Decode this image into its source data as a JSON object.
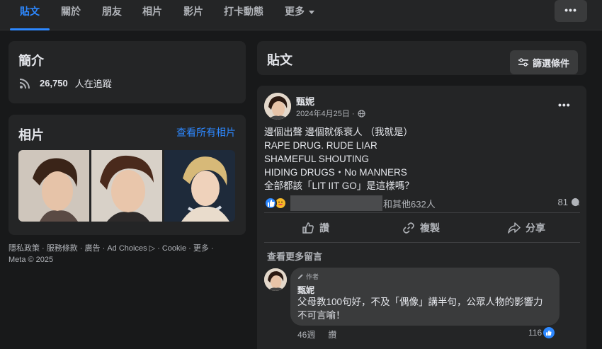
{
  "nav": {
    "tabs": [
      {
        "label": "貼文",
        "active": true
      },
      {
        "label": "關於"
      },
      {
        "label": "朋友"
      },
      {
        "label": "相片"
      },
      {
        "label": "影片"
      },
      {
        "label": "打卡動態"
      },
      {
        "label": "更多"
      }
    ],
    "more_menu_glyph": "•••"
  },
  "intro": {
    "title": "簡介",
    "followers_count": "26,750",
    "followers_text": "人在追蹤",
    "icon": "rss-feed-icon"
  },
  "photos": {
    "title": "相片",
    "see_all_label": "查看所有相片",
    "count_shown": 3
  },
  "footer": {
    "line1": "隱私政策 · 服務條款 · 廣告 · Ad Choices ▷ · Cookie · 更多 ·",
    "line2": "Meta © 2025"
  },
  "posts_header": {
    "title": "貼文",
    "filter_label": "篩選條件"
  },
  "post": {
    "author": "甄妮",
    "date": "2024年4月25日 ·",
    "privacy_icon": "globe-icon",
    "body": "邊個出聲 邊個就係衰人 （我就是）\nRAPE    DRUG.    RUDE  LIAR\nSHAMEFUL    SHOUTING\nHIDING DRUGS・No MANNERS\n全部都該「LIT IIT GO」是這樣嗎？",
    "reactions_others": "和其他632人",
    "comment_count": "81",
    "actions": {
      "like": "讚",
      "copy": "複製",
      "share": "分享"
    }
  },
  "comments": {
    "see_more_label": "查看更多留言",
    "items": [
      {
        "badge": "作者",
        "name": "甄妮",
        "text": "父母教100句好，不及「偶像」講半句，公眾人物的影響力不可言喻！",
        "age": "46週",
        "like_label": "讚",
        "reaction_count": "116"
      }
    ]
  },
  "colors": {
    "background": "#18191a",
    "card": "#242526",
    "accent": "#2d88ff",
    "text_primary": "#e4e6eb",
    "text_secondary": "#b0b3b8"
  }
}
